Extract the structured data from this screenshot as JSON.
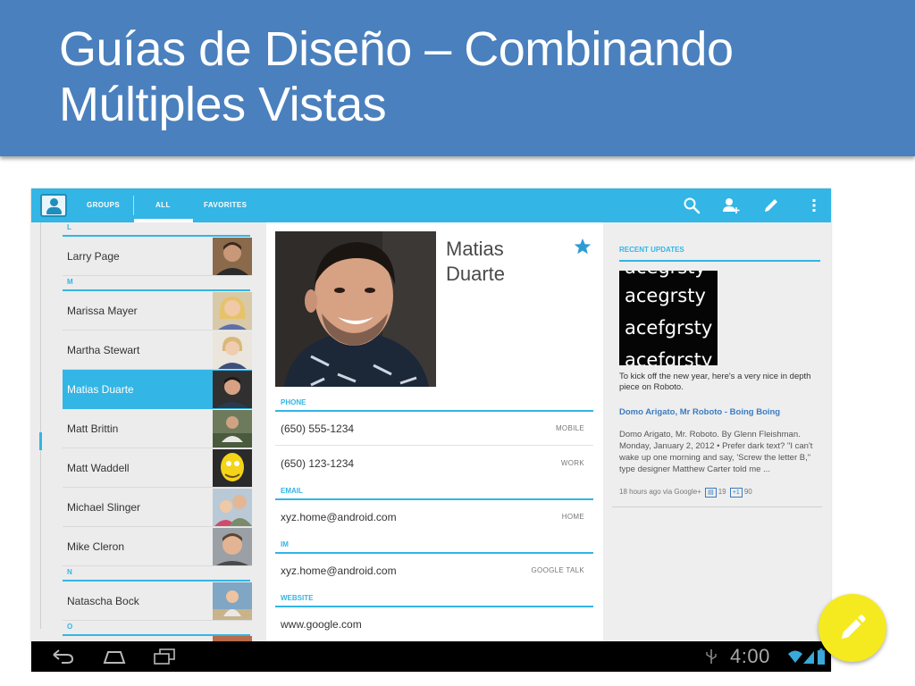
{
  "slide": {
    "title": "Guías de Diseño – Combinando Múltiples Vistas"
  },
  "colors": {
    "banner": "#4a80bd",
    "holo_blue": "#33b5e5",
    "fab_yellow": "#f4ea1f"
  },
  "actionbar": {
    "tabs": [
      "GROUPS",
      "ALL",
      "FAVORITES"
    ],
    "selected_tab": "ALL",
    "icons": [
      "contacts-app-icon",
      "search-icon",
      "add-contact-icon",
      "edit-icon",
      "overflow-menu-icon"
    ]
  },
  "contacts": {
    "sections": {
      "L": "L",
      "M": "M",
      "N": "N",
      "O": "O"
    },
    "items": [
      {
        "name": "Larry Page"
      },
      {
        "name": "Marissa Mayer"
      },
      {
        "name": "Martha Stewart"
      },
      {
        "name": "Matias Duarte"
      },
      {
        "name": "Matt Brittin"
      },
      {
        "name": "Matt Waddell"
      },
      {
        "name": "Michael Slinger"
      },
      {
        "name": "Mike Cleron"
      },
      {
        "name": "Natascha Bock"
      }
    ],
    "selected": "Matias Duarte"
  },
  "detail": {
    "name_line1": "Matias",
    "name_line2": "Duarte",
    "starred": true,
    "phone_header": "PHONE",
    "phones": [
      {
        "value": "(650) 555-1234",
        "kind": "MOBILE"
      },
      {
        "value": "(650) 123-1234",
        "kind": "WORK"
      }
    ],
    "email_header": "EMAIL",
    "email": {
      "value": "xyz.home@android.com",
      "kind": "HOME"
    },
    "im_header": "IM",
    "im": {
      "value": "xyz.home@android.com",
      "kind": "GOOGLE TALK"
    },
    "website_header": "WEBSITE",
    "website": "www.google.com"
  },
  "updates": {
    "header": "RECENT UPDATES",
    "image_samples": [
      "acegrsty",
      "acegrsty",
      "acefgrsty",
      "acefgrsty"
    ],
    "text": "To kick off the new year, here's a very nice in depth piece on Roboto.",
    "link": "Domo Arigato, Mr Roboto - Boing Boing",
    "desc": "Domo Arigato, Mr. Roboto. By Glenn Fleishman. Monday, January 2, 2012 • Prefer dark text? \"I can't wake up one morning and say, 'Screw the letter B,\" type designer Matthew Carter told me ...",
    "meta": "18 hours ago via Google+",
    "comments": "19",
    "plus_ones": "90"
  },
  "systembar": {
    "time": "4:00"
  }
}
